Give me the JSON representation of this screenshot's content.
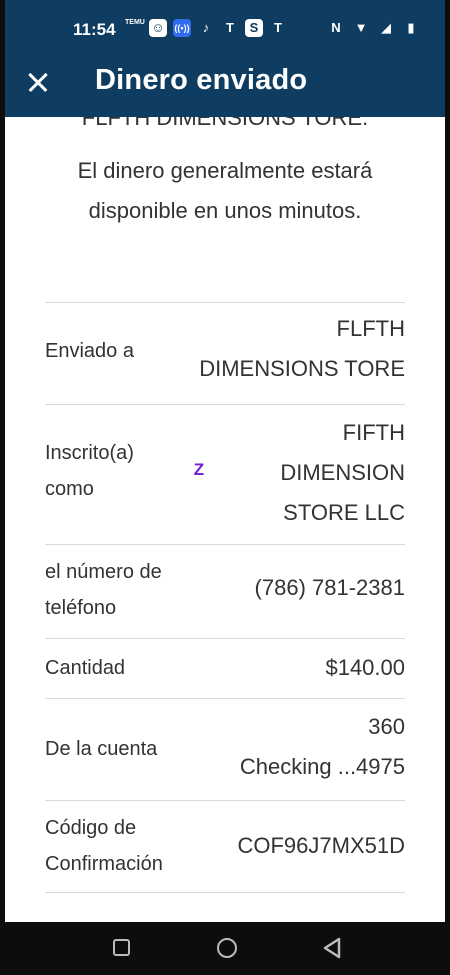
{
  "status_bar": {
    "time": "11:54",
    "icons_left": [
      "temu-icon",
      "smile-icon",
      "radio-icon",
      "tiktok-icon",
      "tmobile-icon",
      "s-icon",
      "tmobile-icon"
    ],
    "temu_text": "TEMU",
    "s_text": "S",
    "t_text": "T",
    "icons_right": [
      "nfc-icon",
      "wifi-icon",
      "signal-icon",
      "battery-icon"
    ]
  },
  "header": {
    "title": "Dinero enviado",
    "close_icon": "close-icon",
    "background": "#0f3d62"
  },
  "content": {
    "cut_text": "FLFTH DIMENSIONS TORE.",
    "message": "El dinero generalmente estará disponible en unos minutos."
  },
  "details": [
    {
      "label": "Enviado a",
      "value_lines": [
        "FLFTH",
        "DIMENSIONS TORE"
      ]
    },
    {
      "label_lines": [
        "Inscrito(a)",
        "como"
      ],
      "value_lines": [
        "FIFTH",
        "DIMENSION",
        "STORE LLC"
      ],
      "icon": "zelle-icon",
      "icon_text": "Z"
    },
    {
      "label_lines": [
        "el número de",
        "teléfono"
      ],
      "value": "(786) 781-2381"
    },
    {
      "label": "Cantidad",
      "value": "$140.00"
    },
    {
      "label": "De la cuenta",
      "value_lines": [
        "360",
        "Checking ...4975"
      ]
    },
    {
      "label_lines": [
        "Código de",
        "Confirmación"
      ],
      "value": "COF96J7MX51D"
    }
  ],
  "colors": {
    "accent": "#0f3d62",
    "zelle": "#6d1ed4",
    "text": "#333333"
  },
  "nav": {
    "icons": [
      "recent-apps-icon",
      "home-icon",
      "back-icon"
    ]
  }
}
